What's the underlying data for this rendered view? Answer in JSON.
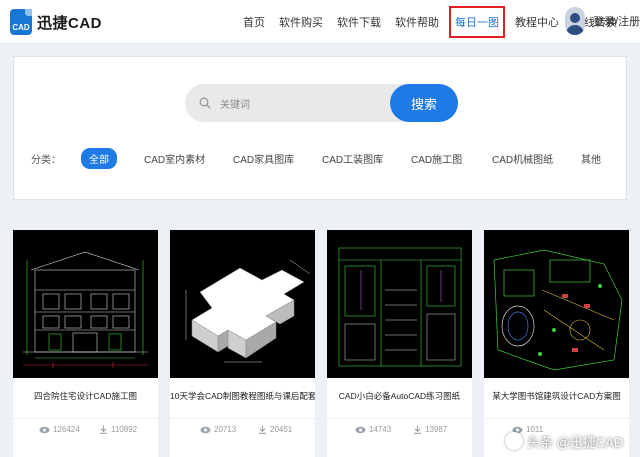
{
  "header": {
    "logo_icon_text": "CAD",
    "logo_text": "迅捷CAD",
    "nav": [
      {
        "label": "首页"
      },
      {
        "label": "软件购买"
      },
      {
        "label": "软件下载"
      },
      {
        "label": "软件帮助"
      },
      {
        "label": "每日一图"
      },
      {
        "label": "教程中心"
      },
      {
        "label": "在线转换"
      }
    ],
    "login_label": "登录/注册"
  },
  "search": {
    "placeholder": "关键词",
    "button_label": "搜索"
  },
  "categories": {
    "label": "分类：",
    "items": [
      "全部",
      "CAD室内素材",
      "CAD家具图库",
      "CAD工装图库",
      "CAD施工图",
      "CAD机械图纸",
      "其他"
    ]
  },
  "cards": [
    {
      "title": "四合院住宅设计CAD施工图",
      "views": "126424",
      "downloads": "110892"
    },
    {
      "title": "10天学会CAD制图教程图纸与课后配套习题",
      "views": "20713",
      "downloads": "20451"
    },
    {
      "title": "CAD小白必备AutoCAD练习图纸",
      "views": "14743",
      "downloads": "13987"
    },
    {
      "title": "某大学图书馆建筑设计CAD方案图",
      "views": "1011",
      "downloads": ""
    }
  ],
  "watermark": "头条 @迅捷CAD",
  "colors": {
    "accent": "#1e7be6",
    "highlight_box": "#e02020"
  }
}
